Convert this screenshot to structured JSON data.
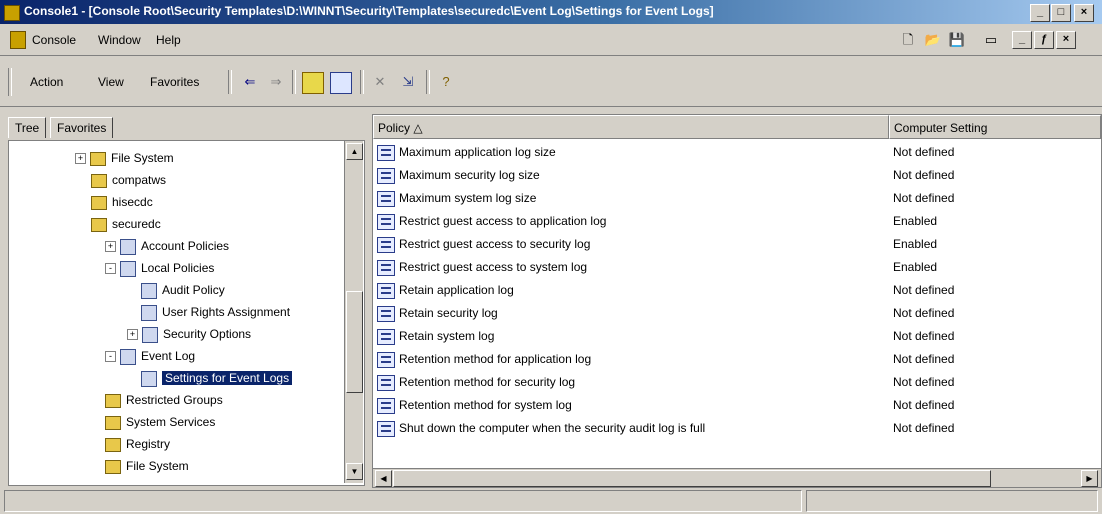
{
  "window": {
    "title": "Console1 - [Console Root\\Security Templates\\D:\\WINNT\\Security\\Templates\\securedc\\Event Log\\Settings for Event Logs]"
  },
  "titlebar_buttons": [
    "_",
    "□",
    "×"
  ],
  "mdi_buttons": [
    "_",
    "ƒ",
    "×"
  ],
  "menu": [
    "Console",
    "Window",
    "Help"
  ],
  "action_menu": [
    "Action",
    "View",
    "Favorites"
  ],
  "tree_tabs": [
    "Tree",
    "Favorites"
  ],
  "tree": [
    {
      "label": "File System",
      "icon": "folder-icon",
      "expander": "+"
    },
    {
      "label": "compatws",
      "icon": "folder-icon",
      "expander": ""
    },
    {
      "label": "hisecdc",
      "icon": "folder-icon",
      "expander": ""
    },
    {
      "label": "securedc",
      "icon": "folder-icon",
      "expander": ""
    },
    {
      "label": "Account Policies",
      "icon": "policy-icon",
      "expander": "+"
    },
    {
      "label": "Local Policies",
      "icon": "policy-icon",
      "expander": "-"
    },
    {
      "label": "Audit Policy",
      "icon": "policy-icon",
      "expander": ""
    },
    {
      "label": "User Rights Assignment",
      "icon": "policy-icon",
      "expander": ""
    },
    {
      "label": "Security Options",
      "icon": "policy-icon",
      "expander": "+"
    },
    {
      "label": "Event Log",
      "icon": "policy-icon",
      "expander": "-"
    },
    {
      "label": "Settings for Event Logs",
      "icon": "policy-icon",
      "expander": ""
    },
    {
      "label": "Restricted Groups",
      "icon": "folder-icon",
      "expander": ""
    },
    {
      "label": "System Services",
      "icon": "folder-icon",
      "expander": ""
    },
    {
      "label": "Registry",
      "icon": "folder-icon",
      "expander": ""
    },
    {
      "label": "File System",
      "icon": "folder-icon",
      "expander": ""
    }
  ],
  "list": {
    "columns": [
      "Policy",
      "Computer Setting"
    ],
    "rows": [
      {
        "policy": "Maximum application log size",
        "setting": "Not defined"
      },
      {
        "policy": "Maximum security log size",
        "setting": "Not defined"
      },
      {
        "policy": "Maximum system log size",
        "setting": "Not defined"
      },
      {
        "policy": "Restrict guest access to application log",
        "setting": "Enabled"
      },
      {
        "policy": "Restrict guest access to security log",
        "setting": "Enabled"
      },
      {
        "policy": "Restrict guest access to system log",
        "setting": "Enabled"
      },
      {
        "policy": "Retain application log",
        "setting": "Not defined"
      },
      {
        "policy": "Retain security log",
        "setting": "Not defined"
      },
      {
        "policy": "Retain system log",
        "setting": "Not defined"
      },
      {
        "policy": "Retention method for application log",
        "setting": "Not defined"
      },
      {
        "policy": "Retention method for security log",
        "setting": "Not defined"
      },
      {
        "policy": "Retention method for system log",
        "setting": "Not defined"
      },
      {
        "policy": "Shut down the computer when the security audit log is full",
        "setting": "Not defined"
      }
    ]
  },
  "colors": {
    "titlebar_start": "#0a246a",
    "titlebar_end": "#a6caf0",
    "selection": "#0a246a",
    "face": "#d4d0c8"
  }
}
